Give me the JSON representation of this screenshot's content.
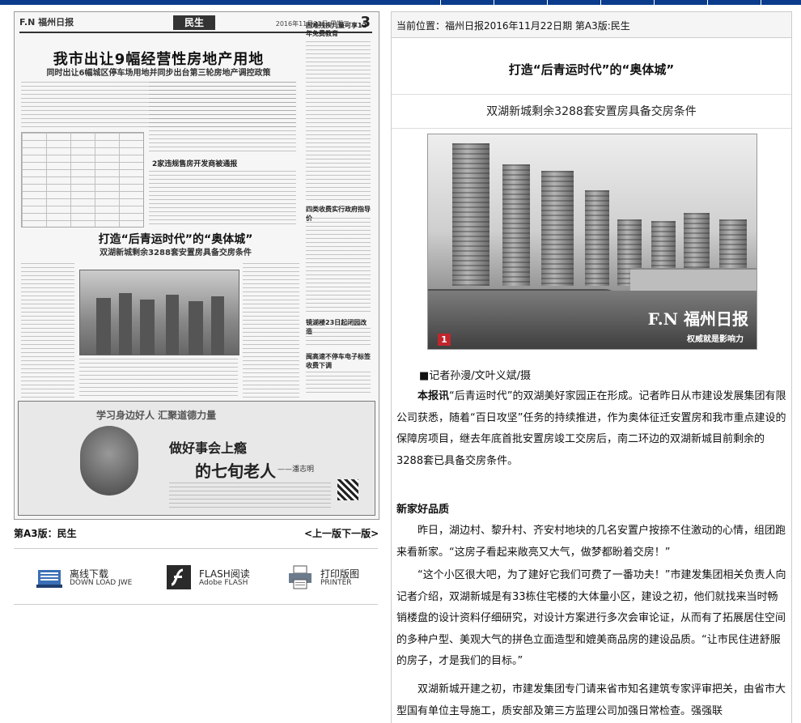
{
  "epaper": {
    "logo": "F.N 福州日报",
    "section": "民生",
    "date": "2016年11月22日 星期二",
    "page_no": "3",
    "headline_main": "我市出让9幅经营性房地产用地",
    "headline_main_sub": "同时出让6幅城区停车场用地并同步出台第三轮房地产调控政策",
    "headline_mid": "2家违规售房开发商被通报",
    "headline_feature": "打造“后青运时代”的“奥体城”",
    "headline_feature_sub": "双湖新城剩余3288套安置房具备交房条件",
    "side_heads": [
      "困难残疾儿童可享12年免费教育",
      "四类收费实行政府指导价",
      "镜湖楼23日起闭园改造",
      "闽高速不停车电子标签收费下调"
    ],
    "ad_slogan": "学习身边好人 汇聚道德力量",
    "ad_title": "做好事会上瘾",
    "ad_title2": "的七旬老人",
    "ad_author": "——潘志明"
  },
  "page_label": "第A3版：民生",
  "nav": {
    "prev": "<上一版",
    "next": "下一版>"
  },
  "tools": [
    {
      "icon": "offline-download-icon",
      "label": "离线下载",
      "sub": "DOWN LOAD JWE"
    },
    {
      "icon": "flash-icon",
      "label": "FLASH阅读",
      "sub": "Adobe FLASH"
    },
    {
      "icon": "printer-icon",
      "label": "打印版图",
      "sub": "PRINTER"
    }
  ],
  "breadcrumb": "当前位置：福州日报2016年11月22日期  第A3版:民生",
  "article": {
    "title": "打造“后青运时代”的“奥体城”",
    "subtitle": "双湖新城剩余3288套安置房具备交房条件",
    "photo_number": "1",
    "photo_watermark": "F.N 福州日报",
    "photo_watermark_sub": "权威就是影响力",
    "byline": "■记者孙漫/文叶义斌/摄",
    "lead_bold": "本报讯",
    "lead": "“后青运时代”的双湖美好家园正在形成。记者昨日从市建设发展集团有限公司获悉，随着“百日攻坚”任务的持续推进，作为奥体征迁安置房和我市重点建设的保障房项目，继去年底首批安置房竣工交房后，南二环边的双湖新城目前剩余的3288套已具备交房条件。",
    "section_head": "新家好品质",
    "p1": "昨日，湖边村、黎升村、齐安村地块的几名安置户按捺不住激动的心情，组团跑来看新家。“这房子看起来敞亮又大气，做梦都盼着交房！”",
    "p2": "“这个小区很大吧，为了建好它我们可费了一番功夫！”市建发集团相关负责人向记者介绍，双湖新城是有33栋住宅楼的大体量小区，建设之初，他们就找来当时畅销楼盘的设计资料仔细研究，对设计方案进行多次会审论证，从而有了拓展居住空间的多种户型、美观大气的拼色立面造型和媲美商品房的建设品质。“让市民住进舒服的房子，才是我们的目标。”",
    "p3": "双湖新城开建之初，市建发集团专门请来省市知名建筑专家评审把关，由省市大型国有单位主导施工，质安部及第三方监理公司加强日常检查。强强联"
  }
}
